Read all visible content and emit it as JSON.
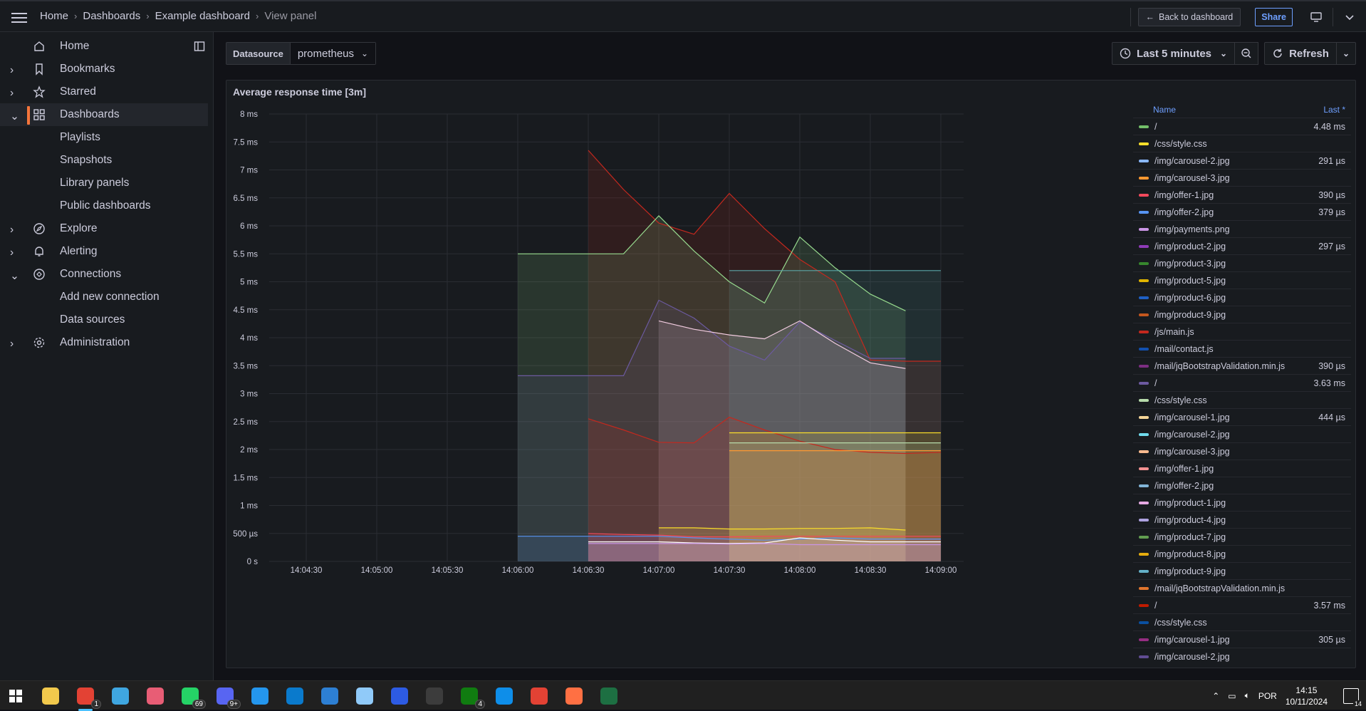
{
  "topbar": {
    "breadcrumbs": [
      "Home",
      "Dashboards",
      "Example dashboard",
      "View panel"
    ],
    "back_label": "Back to dashboard",
    "share_label": "Share"
  },
  "sidebar": {
    "items": [
      {
        "label": "Home",
        "icon": "home-icon"
      },
      {
        "label": "Bookmarks",
        "icon": "bookmark-icon"
      },
      {
        "label": "Starred",
        "icon": "star-icon"
      },
      {
        "label": "Dashboards",
        "icon": "apps-icon"
      },
      {
        "label": "Playlists"
      },
      {
        "label": "Snapshots"
      },
      {
        "label": "Library panels"
      },
      {
        "label": "Public dashboards"
      },
      {
        "label": "Explore",
        "icon": "compass-icon"
      },
      {
        "label": "Alerting",
        "icon": "bell-icon"
      },
      {
        "label": "Connections",
        "icon": "plug-icon"
      },
      {
        "label": "Add new connection"
      },
      {
        "label": "Data sources"
      },
      {
        "label": "Administration",
        "icon": "gear-icon"
      }
    ]
  },
  "controls": {
    "datasource_label": "Datasource",
    "datasource_value": "prometheus",
    "time_range": "Last 5 minutes",
    "refresh_label": "Refresh"
  },
  "panel": {
    "title": "Average response time [3m]"
  },
  "chart_data": {
    "type": "area",
    "y_ticks": [
      "8 ms",
      "7.5 ms",
      "7 ms",
      "6.5 ms",
      "6 ms",
      "5.5 ms",
      "5 ms",
      "4.5 ms",
      "4 ms",
      "3.5 ms",
      "3 ms",
      "2.5 ms",
      "2 ms",
      "1.5 ms",
      "1 ms",
      "500 µs",
      "0 s"
    ],
    "x_ticks": [
      "14:04:30",
      "14:05:00",
      "14:05:30",
      "14:06:00",
      "14:06:30",
      "14:07:00",
      "14:07:30",
      "14:08:00",
      "14:08:30",
      "14:09:00"
    ],
    "ylim": [
      0,
      8
    ],
    "grid": true,
    "legend_placement": "right",
    "x_times": [
      "14:06:00",
      "14:06:15",
      "14:06:30",
      "14:06:45",
      "14:07:00",
      "14:07:15",
      "14:07:30",
      "14:07:45",
      "14:08:00",
      "14:08:15",
      "14:08:30",
      "14:08:45",
      "14:09:00"
    ],
    "series": [
      {
        "color": "#c4281e",
        "values": [
          null,
          null,
          7.35,
          6.65,
          6.05,
          5.85,
          6.58,
          5.95,
          5.4,
          5.0,
          3.6,
          3.58,
          3.58
        ]
      },
      {
        "color": "#96d98d",
        "values": [
          5.5,
          5.5,
          5.5,
          5.5,
          6.18,
          5.55,
          5.0,
          4.62,
          5.8,
          5.25,
          4.78,
          4.48,
          null
        ]
      },
      {
        "color": "#6c5aa0",
        "values": [
          3.32,
          3.32,
          3.32,
          3.32,
          4.67,
          4.35,
          3.85,
          3.6,
          4.28,
          3.95,
          3.63,
          3.63,
          null
        ]
      },
      {
        "color": "#f2cce0",
        "values": [
          null,
          null,
          null,
          null,
          4.3,
          4.15,
          4.05,
          3.98,
          4.3,
          3.9,
          3.55,
          3.45,
          null
        ]
      },
      {
        "color": "#5ba7a8",
        "values": [
          null,
          null,
          null,
          null,
          null,
          null,
          5.2,
          5.2,
          5.2,
          5.2,
          5.2,
          5.2,
          5.2
        ]
      },
      {
        "color": "#c4281e",
        "values": [
          null,
          null,
          2.55,
          2.35,
          2.13,
          2.12,
          2.58,
          2.35,
          2.15,
          2.0,
          1.95,
          1.93,
          1.95
        ]
      },
      {
        "color": "#fade2a",
        "values": [
          null,
          null,
          null,
          null,
          null,
          null,
          2.3,
          2.3,
          2.3,
          2.3,
          2.3,
          2.3,
          2.3
        ]
      },
      {
        "color": "#b7dbab",
        "values": [
          null,
          null,
          null,
          null,
          null,
          null,
          2.12,
          2.12,
          2.12,
          2.12,
          2.12,
          2.12,
          2.12
        ]
      },
      {
        "color": "#ff9830",
        "values": [
          null,
          null,
          null,
          null,
          null,
          null,
          1.98,
          1.98,
          1.98,
          1.98,
          1.98,
          1.98,
          1.98
        ]
      },
      {
        "color": "#fade2a",
        "values": [
          null,
          null,
          null,
          null,
          0.6,
          0.6,
          0.58,
          0.58,
          0.59,
          0.59,
          0.6,
          0.56,
          null
        ]
      },
      {
        "color": "#5794f2",
        "values": [
          0.45,
          0.45,
          0.45,
          0.45,
          0.45,
          0.42,
          0.4,
          0.38,
          0.4,
          0.42,
          0.4,
          0.4,
          0.4
        ]
      },
      {
        "color": "#f2495c",
        "values": [
          null,
          null,
          0.5,
          0.48,
          0.47,
          0.44,
          0.44,
          0.45,
          0.45,
          0.45,
          0.45,
          0.45,
          0.45
        ]
      },
      {
        "color": "#ffffff",
        "values": [
          null,
          null,
          0.35,
          0.35,
          0.35,
          0.33,
          0.32,
          0.33,
          0.42,
          0.38,
          0.35,
          0.35,
          0.35
        ]
      },
      {
        "color": "#ca95e5",
        "values": [
          null,
          null,
          0.32,
          0.32,
          0.32,
          0.32,
          0.31,
          0.32,
          0.3,
          0.3,
          0.3,
          0.3,
          0.3
        ]
      }
    ],
    "legend": {
      "headers": [
        "Name",
        "Last *"
      ],
      "items": [
        {
          "name": "/",
          "value": "4.48 ms",
          "color": "#73bf69"
        },
        {
          "name": "/css/style.css",
          "value": "",
          "color": "#fade2a"
        },
        {
          "name": "/img/carousel-2.jpg",
          "value": "291 µs",
          "color": "#8ab8ff"
        },
        {
          "name": "/img/carousel-3.jpg",
          "value": "",
          "color": "#ff9830"
        },
        {
          "name": "/img/offer-1.jpg",
          "value": "390 µs",
          "color": "#f2495c"
        },
        {
          "name": "/img/offer-2.jpg",
          "value": "379 µs",
          "color": "#5794f2"
        },
        {
          "name": "/img/payments.png",
          "value": "",
          "color": "#ca95e5"
        },
        {
          "name": "/img/product-2.jpg",
          "value": "297 µs",
          "color": "#8f3bb8"
        },
        {
          "name": "/img/product-3.jpg",
          "value": "",
          "color": "#37872d"
        },
        {
          "name": "/img/product-5.jpg",
          "value": "",
          "color": "#e0b400"
        },
        {
          "name": "/img/product-6.jpg",
          "value": "",
          "color": "#1f60c4"
        },
        {
          "name": "/img/product-9.jpg",
          "value": "",
          "color": "#c4571e"
        },
        {
          "name": "/js/main.js",
          "value": "",
          "color": "#c4281e"
        },
        {
          "name": "/mail/contact.js",
          "value": "",
          "color": "#1250b0"
        },
        {
          "name": "/mail/jqBootstrapValidation.min.js",
          "value": "390 µs",
          "color": "#7c2e82"
        },
        {
          "name": "/",
          "value": "3.63 ms",
          "color": "#6c5aa0"
        },
        {
          "name": "/css/style.css",
          "value": "",
          "color": "#b7dbab"
        },
        {
          "name": "/img/carousel-1.jpg",
          "value": "444 µs",
          "color": "#f4d598"
        },
        {
          "name": "/img/carousel-2.jpg",
          "value": "",
          "color": "#70dbed"
        },
        {
          "name": "/img/carousel-3.jpg",
          "value": "",
          "color": "#f9ba8f"
        },
        {
          "name": "/img/offer-1.jpg",
          "value": "",
          "color": "#f29191"
        },
        {
          "name": "/img/offer-2.jpg",
          "value": "",
          "color": "#82b5d8"
        },
        {
          "name": "/img/product-1.jpg",
          "value": "",
          "color": "#e5a8e2"
        },
        {
          "name": "/img/product-4.jpg",
          "value": "",
          "color": "#aea2e0"
        },
        {
          "name": "/img/product-7.jpg",
          "value": "",
          "color": "#629e51"
        },
        {
          "name": "/img/product-8.jpg",
          "value": "",
          "color": "#e5ac0e"
        },
        {
          "name": "/img/product-9.jpg",
          "value": "",
          "color": "#64b0c8"
        },
        {
          "name": "/mail/jqBootstrapValidation.min.js",
          "value": "",
          "color": "#e0752d"
        },
        {
          "name": "/",
          "value": "3.57 ms",
          "color": "#bf1b00"
        },
        {
          "name": "/css/style.css",
          "value": "",
          "color": "#0a50a1"
        },
        {
          "name": "/img/carousel-1.jpg",
          "value": "305 µs",
          "color": "#962d82"
        },
        {
          "name": "/img/carousel-2.jpg",
          "value": "",
          "color": "#614d93"
        }
      ]
    }
  },
  "taskbar": {
    "apps": [
      {
        "icon": "windows-start-icon",
        "badge": ""
      },
      {
        "icon": "file-explorer-icon",
        "badge": ""
      },
      {
        "icon": "chrome-icon",
        "badge": "1"
      },
      {
        "icon": "store-icon",
        "badge": ""
      },
      {
        "icon": "app-icon",
        "badge": ""
      },
      {
        "icon": "whatsapp-icon",
        "badge": "69"
      },
      {
        "icon": "discord-icon",
        "badge": "9+"
      },
      {
        "icon": "docker-icon",
        "badge": ""
      },
      {
        "icon": "vscode-icon",
        "badge": ""
      },
      {
        "icon": "photos-icon",
        "badge": ""
      },
      {
        "icon": "notepad-icon",
        "badge": ""
      },
      {
        "icon": "app-icon",
        "badge": ""
      },
      {
        "icon": "terminal-icon",
        "badge": ""
      },
      {
        "icon": "xbox-icon",
        "badge": "4"
      },
      {
        "icon": "teamviewer-icon",
        "badge": ""
      },
      {
        "icon": "chrome-icon",
        "badge": ""
      },
      {
        "icon": "app-icon",
        "badge": ""
      },
      {
        "icon": "excel-icon",
        "badge": ""
      }
    ],
    "lang": "POR",
    "time": "14:15",
    "date": "10/11/2024",
    "notifications": "14"
  }
}
